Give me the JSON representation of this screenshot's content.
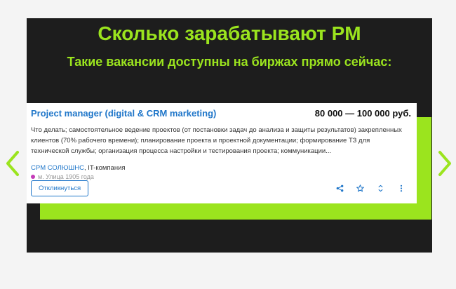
{
  "slide": {
    "title": "Сколько зарабатывают PM",
    "subtitle": "Такие вакансии доступны на биржах прямо сейчас:"
  },
  "vacancy": {
    "title": "Project manager (digital & CRM marketing)",
    "salary": "80 000 — 100 000 руб.",
    "description": "Что делать; самостоятельное ведение проектов (от постановки задач до анализа и защиты результатов) закрепленных клиентов (70% рабочего времени); планирование проекта и проектной документации; формирование ТЗ для технической службы; организация процесса настройки и тестирования проекта; коммуникации...",
    "company": "CPM СОЛЮШНС",
    "company_type": ", IT-компания",
    "metro": "м. Улица 1905 года",
    "respond_label": "Откликнуться"
  },
  "icons": {
    "prev": "chevron-left-icon",
    "next": "chevron-right-icon",
    "share": "share-icon",
    "favorite": "star-icon",
    "hide": "expand-icon",
    "more": "more-vertical-icon"
  },
  "colors": {
    "accent_green": "#9be41e",
    "slide_bg": "#1d1d1d",
    "link_blue": "#1f76c9",
    "metro_dot": "#c43bb8"
  }
}
